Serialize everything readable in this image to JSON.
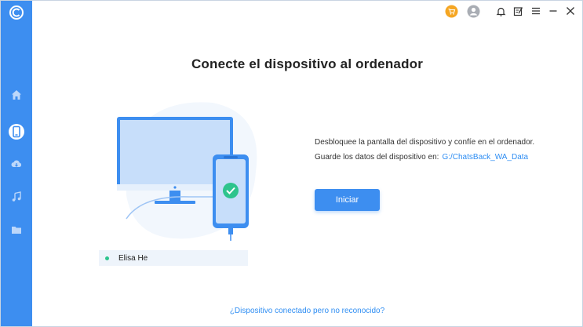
{
  "window": {
    "title": "Conecte el dispositivo al ordenador"
  },
  "sidebar": {
    "items": [
      {
        "icon": "home-icon",
        "active": false
      },
      {
        "icon": "phone-icon",
        "active": true
      },
      {
        "icon": "cloud-icon",
        "active": false
      },
      {
        "icon": "music-icon",
        "active": false
      },
      {
        "icon": "folder-icon",
        "active": false
      }
    ]
  },
  "topbar": {
    "icons": [
      "cart-icon",
      "user-icon",
      "bell-icon",
      "feedback-icon",
      "menu-icon",
      "close-icon"
    ]
  },
  "device": {
    "name": "Elisa He",
    "status_color": "#2ec48d"
  },
  "instructions": {
    "line1": "Desbloquee la pantalla del dispositivo y confíe en el ordenador.",
    "line2_label": "Guarde los datos del dispositivo en:",
    "line2_path": "G:/ChatsBack_WA_Data"
  },
  "actions": {
    "start_label": "Iniciar"
  },
  "help": {
    "link_text": "¿Dispositivo conectado pero no reconocido?"
  },
  "colors": {
    "accent": "#3d8ef0",
    "link": "#2f8ef3",
    "cart": "#f5a623",
    "success": "#2ec48d"
  }
}
